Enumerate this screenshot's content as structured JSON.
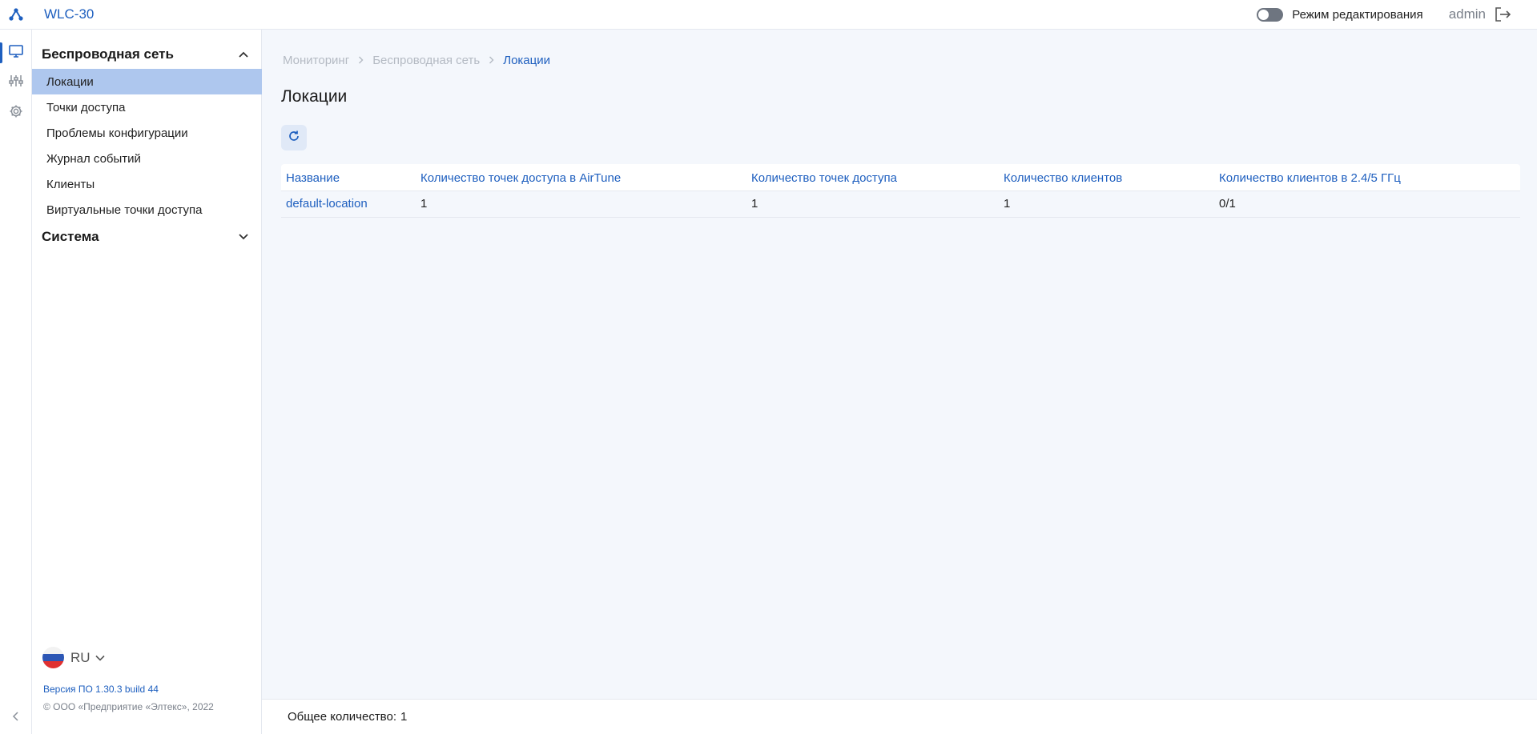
{
  "app": {
    "title": "WLC-30"
  },
  "topbar": {
    "edit_mode_label": "Режим редактирования",
    "user": "admin"
  },
  "rail": {
    "items": [
      {
        "icon": "monitor-icon",
        "active": true
      },
      {
        "icon": "sliders-icon",
        "active": false
      },
      {
        "icon": "gear-icon",
        "active": false
      }
    ]
  },
  "sidebar": {
    "sections": [
      {
        "title": "Беспроводная сеть",
        "expanded": true,
        "items": [
          {
            "label": "Локации",
            "active": true
          },
          {
            "label": "Точки доступа"
          },
          {
            "label": "Проблемы конфигурации"
          },
          {
            "label": "Журнал событий"
          },
          {
            "label": "Клиенты"
          },
          {
            "label": "Виртуальные точки доступа"
          }
        ]
      },
      {
        "title": "Система",
        "expanded": false
      }
    ],
    "language": "RU",
    "version": "Версия ПО 1.30.3 build 44",
    "copyright": "© ООО «Предприятие «Элтекс», 2022"
  },
  "breadcrumb": [
    "Мониторинг",
    "Беспроводная сеть",
    "Локации"
  ],
  "page_title": "Локации",
  "table": {
    "columns": [
      "Название",
      "Количество точек доступа в AirTune",
      "Количество точек доступа",
      "Количество клиентов",
      "Количество клиентов в 2.4/5 ГГц"
    ],
    "rows": [
      [
        "default-location",
        "1",
        "1",
        "1",
        "0/1"
      ]
    ]
  },
  "footer": {
    "total_label": "Общее количество:",
    "total_value": "1"
  },
  "colors": {
    "accent": "#1e5fbf",
    "active_item_bg": "#aec7ee",
    "page_bg": "#f4f7fc"
  }
}
